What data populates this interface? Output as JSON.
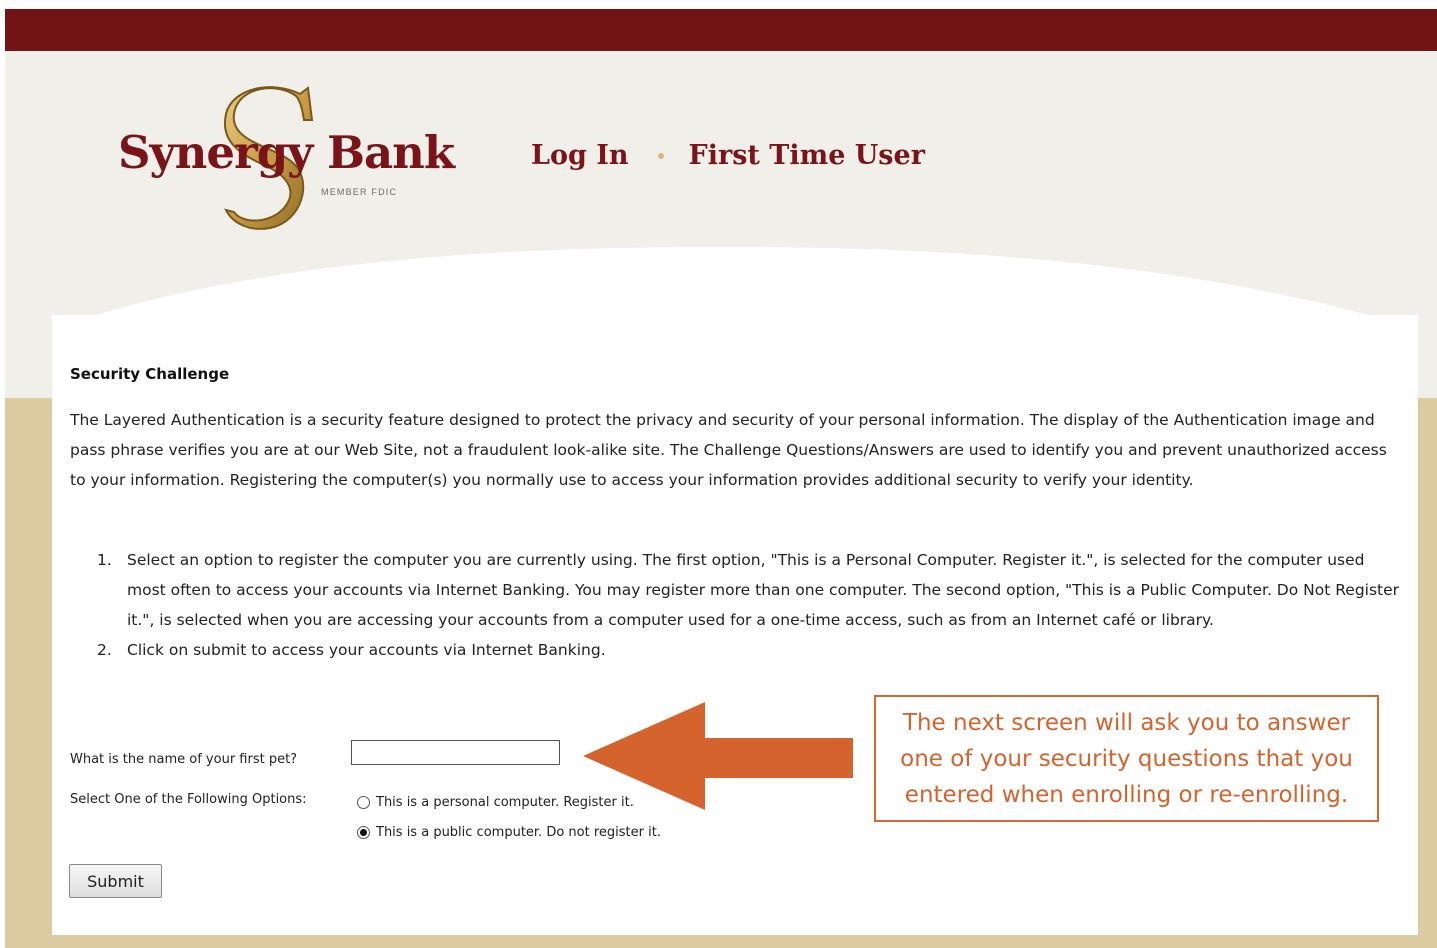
{
  "brand": {
    "name": "Synergy Bank",
    "tagline": "MEMBER FDIC",
    "colors": {
      "primary": "#721316",
      "gold": "#c99c43",
      "sand": "#dccba0",
      "cream": "#f1efe9"
    }
  },
  "nav": {
    "login_label": "Log In",
    "first_time_label": "First Time User"
  },
  "main": {
    "title": "Security Challenge",
    "intro": "The Layered Authentication is a security feature designed to protect the privacy and security of your personal information. The display of the Authentication image and pass phrase verifies you are at our Web Site, not a fraudulent look-alike site. The Challenge Questions/Answers are used to identify you and prevent unauthorized access to your information. Registering the computer(s) you normally use to access your information provides additional security to verify your identity.",
    "steps": [
      {
        "num": "1.",
        "text": "Select an option to register the computer you are currently using. The first option, \"This is a Personal Computer. Register it.\", is selected for the computer used most often to access your accounts via Internet Banking. You may register more than one computer. The second option, \"This is a Public Computer. Do Not Register it.\", is selected when you are accessing your accounts from a computer used for a one-time access, such as from an Internet café or library."
      },
      {
        "num": "2.",
        "text": "Click on submit to access your accounts via Internet Banking."
      }
    ]
  },
  "form": {
    "question_label": "What is the name of your first pet?",
    "answer_value": "",
    "options_label": "Select One of the Following Options:",
    "options": [
      {
        "label": "This is a personal computer. Register it.",
        "checked": false
      },
      {
        "label": "This is a public computer. Do not register it.",
        "checked": true
      }
    ],
    "submit_label": "Submit"
  },
  "annotation": {
    "callout_lines": [
      "The next screen will ask you to answer",
      "one of your security questions that you",
      "entered when enrolling or re-enrolling."
    ],
    "arrow_color": "#d4632e"
  }
}
